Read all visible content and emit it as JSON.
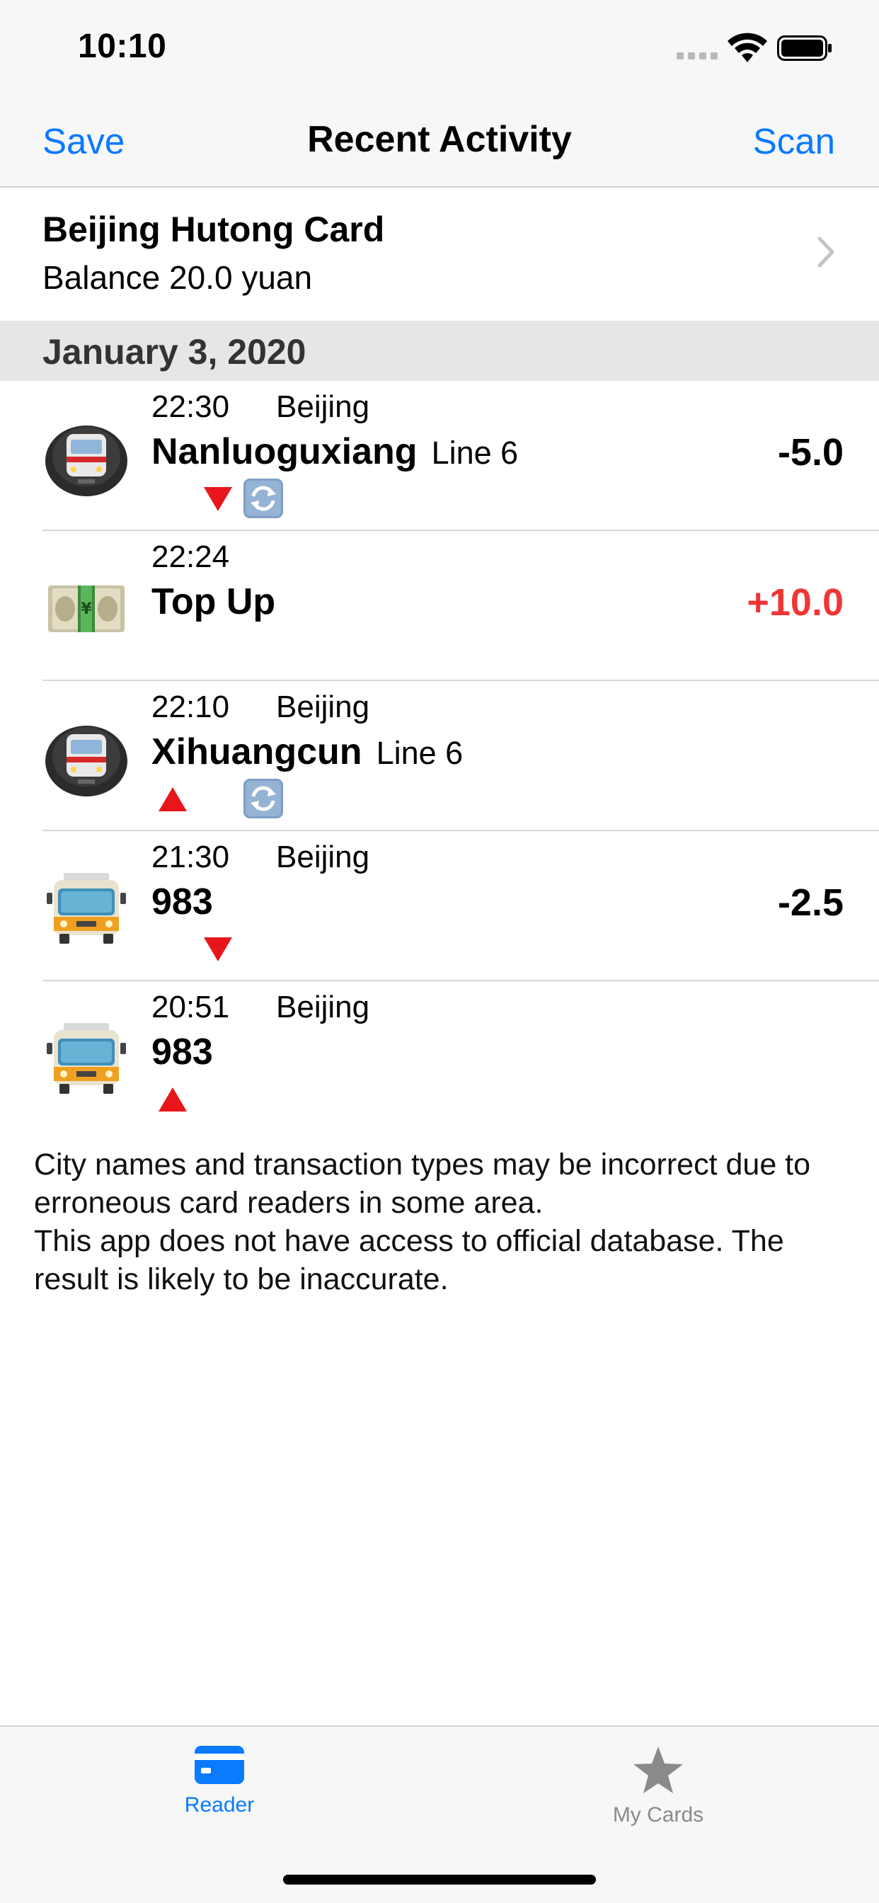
{
  "status_bar": {
    "time": "10:10",
    "icons": [
      "signal-dots-icon",
      "wifi-icon",
      "battery-icon"
    ]
  },
  "nav": {
    "left_button": "Save",
    "title": "Recent Activity",
    "right_button": "Scan"
  },
  "card": {
    "name": "Beijing Hutong Card",
    "balance": "Balance 20.0 yuan"
  },
  "section": {
    "date": "January 3, 2020"
  },
  "transactions": [
    {
      "icon": "metro-train-icon",
      "time": "22:30",
      "city": "Beijing",
      "title": "Nanluoguxiang",
      "line": "Line 6",
      "amount": "-5.0",
      "direction": "exit-down-triangle",
      "sync": true
    },
    {
      "icon": "money-banknote-icon",
      "time": "22:24",
      "city": "",
      "title": "Top Up",
      "line": "",
      "amount": "+10.0",
      "direction": "",
      "sync": false
    },
    {
      "icon": "metro-train-icon",
      "time": "22:10",
      "city": "Beijing",
      "title": "Xihuangcun",
      "line": "Line 6",
      "amount": "",
      "direction": "entry-up-triangle",
      "sync": true
    },
    {
      "icon": "bus-icon",
      "time": "21:30",
      "city": "Beijing",
      "title": "983",
      "line": "",
      "amount": "-2.5",
      "direction": "exit-down-triangle",
      "sync": false
    },
    {
      "icon": "bus-icon",
      "time": "20:51",
      "city": "Beijing",
      "title": "983",
      "line": "",
      "amount": "",
      "direction": "entry-up-triangle",
      "sync": false
    }
  ],
  "disclaimer": {
    "line1": "City names and transaction types may be incorrect due to erroneous card readers in some area.",
    "line2": "This app does not have access to official database. The result is likely to be inaccurate."
  },
  "tabbar": {
    "reader_label": "Reader",
    "cards_label": "My Cards"
  },
  "colors": {
    "accent": "#0a7aff",
    "positive_amount": "#f03535",
    "section_bg": "#e6e6e6"
  }
}
